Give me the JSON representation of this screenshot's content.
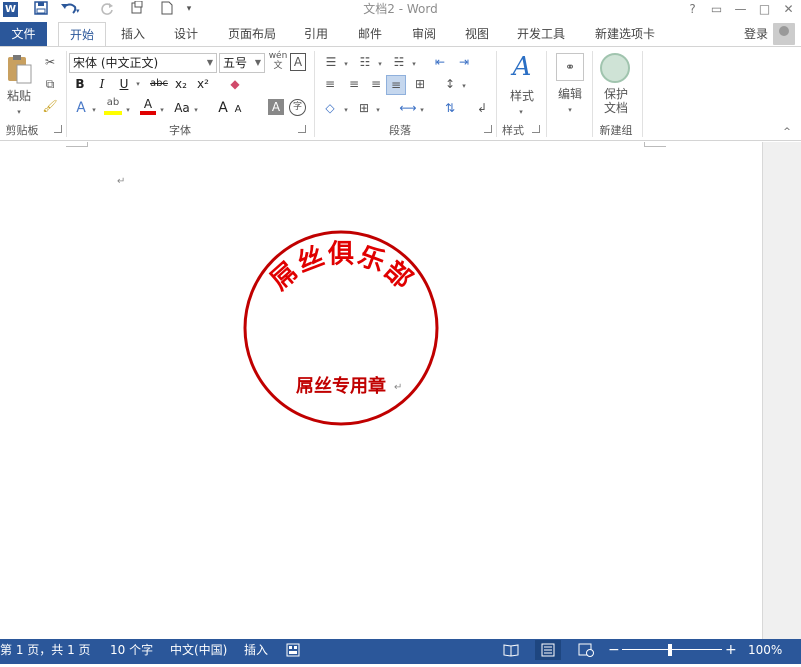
{
  "window": {
    "title": "文档2 - Word",
    "app_icon": "W",
    "controls": [
      "?",
      "▭",
      "—",
      "□",
      "✕"
    ]
  },
  "qat": {
    "save_icon": "save-icon",
    "undo_icon": "undo-icon",
    "redo_icon": "redo-icon"
  },
  "tabs": {
    "file": "文件",
    "items": [
      "开始",
      "插入",
      "设计",
      "页面布局",
      "引用",
      "邮件",
      "审阅",
      "视图",
      "开发工具",
      "新建选项卡"
    ],
    "login": "登录"
  },
  "ribbon": {
    "clipboard": {
      "label": "剪贴板",
      "paste": "粘贴"
    },
    "font": {
      "label": "字体",
      "font_name": "宋体 (中文正文)",
      "font_size": "五号",
      "bold": "B",
      "italic": "I",
      "underline": "U",
      "strike": "abc",
      "sub": "x₂",
      "sup": "x²",
      "case": "Aa",
      "grow": "A",
      "char_border": "A",
      "enclose": "字",
      "phonetic": "wén"
    },
    "paragraph": {
      "label": "段落"
    },
    "styles": {
      "label": "样式",
      "btn": "样式"
    },
    "editing": {
      "btn": "编辑"
    },
    "newgroup": {
      "label": "新建组",
      "btn_line1": "保护",
      "btn_line2": "文档"
    }
  },
  "document": {
    "para_mark": "↵",
    "seal": {
      "top_text": "屌丝俱乐部",
      "bottom_text": "屌丝专用章",
      "color": "#c00000"
    }
  },
  "status": {
    "page": "第 1 页，共 1 页",
    "words": "10 个字",
    "lang": "中文(中国)",
    "mode": "插入",
    "zoom": "100%",
    "zoom_minus": "−",
    "zoom_plus": "+"
  }
}
